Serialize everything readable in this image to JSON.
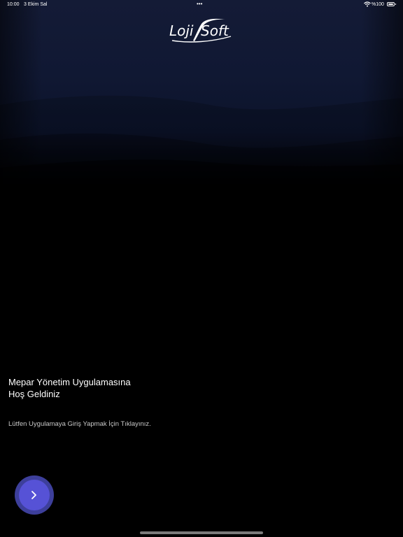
{
  "status_bar": {
    "time": "10:00",
    "date": "3 Ekim Sal",
    "multitask_dots": "•••",
    "battery_text": "%100",
    "wifi_icon": "wifi-icon",
    "battery_icon": "battery-icon"
  },
  "logo": {
    "text_left": "Loji",
    "text_right": "Soft"
  },
  "welcome": {
    "title_line1": "Mepar Yönetim Uygulamasına",
    "title_line2": "Hoş Geldiniz",
    "subtitle": "Lütfen Uygulamaya Giriş Yapmak İçin Tıklayınız."
  },
  "next_button": {
    "icon": "chevron-right-icon",
    "color": "#5652d6",
    "ring_color": "#3d3f9b"
  },
  "colors": {
    "background": "#000000",
    "header_navy": "#101833",
    "text": "#ffffff",
    "subtext": "#c8c8c8"
  }
}
